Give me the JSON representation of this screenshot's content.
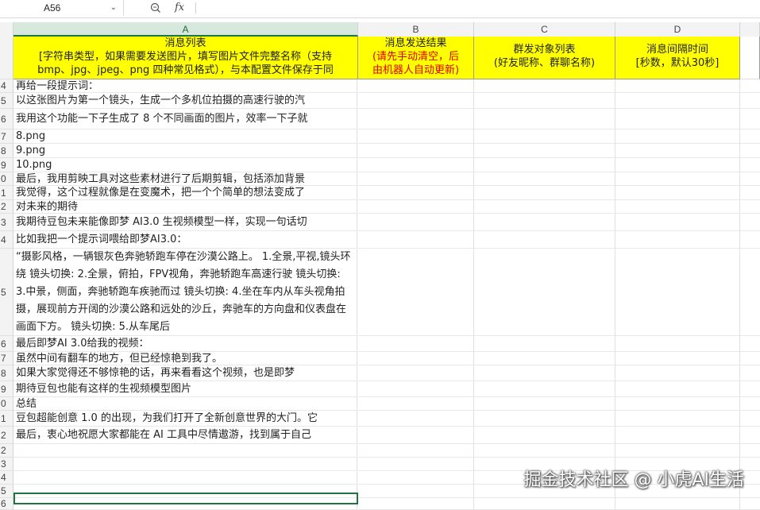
{
  "formula_bar": {
    "cell_ref": "A56",
    "fx_label": "fx"
  },
  "columns": [
    "A",
    "B",
    "C",
    "D"
  ],
  "header_row": {
    "a_line1": "消息列表",
    "a_line2": "[字符串类型，如果需要发送图片，填写图片文件完整名称（支持",
    "a_line3": "bmp、jpg、jpeg、png 四种常见格式），与本配置文件保存于同",
    "b_line1": "消息发送结果",
    "b_line2_red": "(请先手动清空，后",
    "b_line3_red": "由机器人自动更新)",
    "c_line1": "群发对象列表",
    "c_line2": "(好友昵称、群聊名称)",
    "d_line1": "消息间隔时间",
    "d_line2": "[秒数，默认30秒]"
  },
  "rows": [
    {
      "num": "4",
      "text": "再给一段提示词："
    },
    {
      "num": "5",
      "text": "以这张图片为第一个镜头，生成一个多机位拍摄的高速行驶的汽"
    },
    {
      "num": "6",
      "text": "我用这个功能一下子生成了 8 个不同画面的图片，效率一下子就"
    },
    {
      "num": "7",
      "text": "8.png"
    },
    {
      "num": "8",
      "text": "9.png"
    },
    {
      "num": "9",
      "text": "10.png"
    },
    {
      "num": "0",
      "text": "最后，我用剪映工具对这些素材进行了后期剪辑，包括添加背景"
    },
    {
      "num": "1",
      "text": "我觉得，这个过程就像是在变魔术，把一个个简单的想法变成了"
    },
    {
      "num": "2",
      "text": "对未来的期待"
    },
    {
      "num": "3",
      "text": "我期待豆包未来能像即梦 AI3.0 生视频模型一样，实现一句话切"
    },
    {
      "num": "4",
      "text": "比如我把一个提示词喂给即梦AI3.0："
    },
    {
      "num": "5",
      "text": "“摄影风格，一辆银灰色奔驰轿跑车停在沙漠公路上。 1.全景,平视,镜头环绕 镜头切换: 2.全景，俯拍，FPV视角，奔驰轿跑车高速行驶 镜头切换: 3.中景，侧面，奔驰轿跑车疾驰而过 镜头切换: 4.坐在车内从车头视角拍摄，展现前方开阔的沙漠公路和远处的沙丘，奔驰车的方向盘和仪表盘在画面下方。 镜头切换: 5.从车尾后"
    },
    {
      "num": "6",
      "text": "最后即梦AI 3.0给我的视频："
    },
    {
      "num": "7",
      "text": "虽然中间有翻车的地方，但已经惊艳到我了。"
    },
    {
      "num": "8",
      "text": "如果大家觉得还不够惊艳的话，再来看看这个视频，也是即梦"
    },
    {
      "num": "9",
      "text": "期待豆包也能有这样的生视频模型图片"
    },
    {
      "num": "0",
      "text": "总结"
    },
    {
      "num": "1",
      "text": "豆包超能创意 1.0 的出现，为我们打开了全新创意世界的大门。它"
    },
    {
      "num": "2",
      "text": "最后，衷心地祝愿大家都能在 AI 工具中尽情遨游，找到属于自己"
    },
    {
      "num": "2",
      "text": ""
    },
    {
      "num": "3",
      "text": ""
    },
    {
      "num": "4",
      "text": ""
    },
    {
      "num": "5",
      "text": ""
    },
    {
      "num": "6",
      "text": ""
    }
  ],
  "watermark": "掘金技术社区 @ 小虎AI生活"
}
